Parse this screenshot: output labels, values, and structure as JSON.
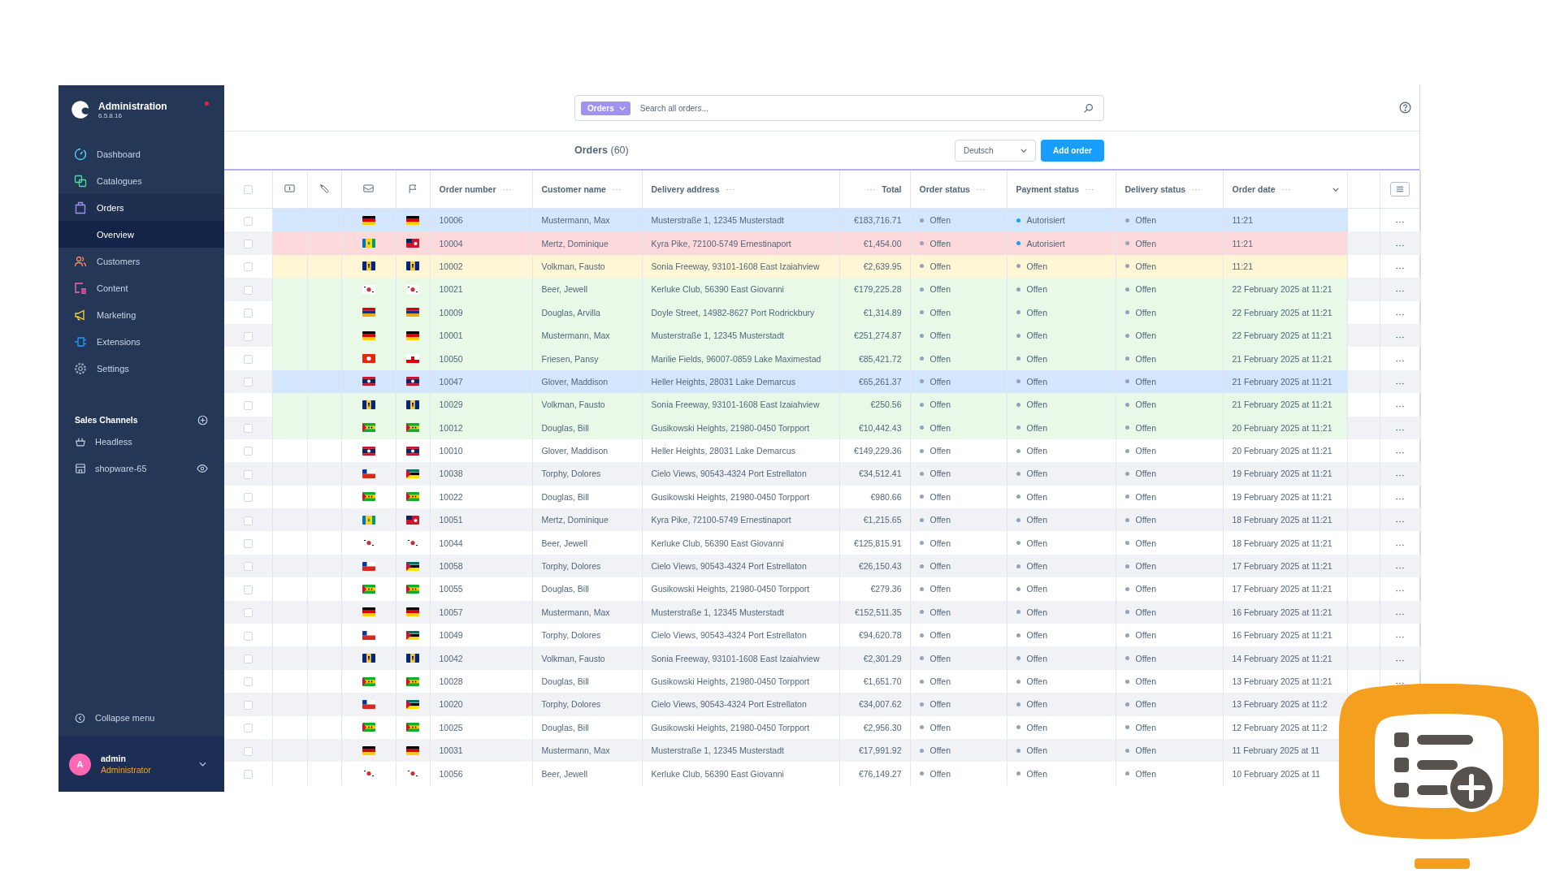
{
  "sidebar": {
    "title": "Administration",
    "version": "6.5.8.16",
    "notification": true,
    "items": [
      {
        "label": "Dashboard",
        "kind": "dashboard",
        "expanded": false,
        "selected": false
      },
      {
        "label": "Catalogues",
        "kind": "catalogues",
        "expanded": false,
        "selected": false
      },
      {
        "label": "Orders",
        "kind": "orders",
        "expanded": true,
        "selected": false,
        "children": [
          {
            "label": "Overview",
            "selected": true
          }
        ]
      },
      {
        "label": "Customers",
        "kind": "customers",
        "expanded": false,
        "selected": false
      },
      {
        "label": "Content",
        "kind": "content",
        "expanded": false,
        "selected": false
      },
      {
        "label": "Marketing",
        "kind": "marketing",
        "expanded": false,
        "selected": false
      },
      {
        "label": "Extensions",
        "kind": "extensions",
        "expanded": false,
        "selected": false
      },
      {
        "label": "Settings",
        "kind": "settings",
        "expanded": false,
        "selected": false
      }
    ],
    "sales_channels": {
      "title": "Sales Channels",
      "items": [
        {
          "label": "Headless",
          "kind": "headless"
        },
        {
          "label": "shopware-65",
          "kind": "storefront"
        }
      ]
    },
    "collapse": "Collapse menu",
    "user": {
      "initial": "A",
      "name": "admin",
      "role": "Administrator"
    }
  },
  "search": {
    "scope": "Orders",
    "placeholder": "Search all orders..."
  },
  "header": {
    "title": "Orders",
    "count": "(60)",
    "language": "Deutsch",
    "add_button": "Add order"
  },
  "table": {
    "header_checked": false,
    "columns": [
      {
        "kind": "checkbox"
      },
      {
        "kind": "money"
      },
      {
        "kind": "tag"
      },
      {
        "kind": "mail"
      },
      {
        "kind": "flag"
      },
      {
        "kind": "text",
        "label": "Order number",
        "sorted": false
      },
      {
        "kind": "text",
        "label": "Customer name",
        "sorted": false
      },
      {
        "kind": "text",
        "label": "Delivery address",
        "sorted": false
      },
      {
        "kind": "number",
        "label": "Total",
        "sorted": false
      },
      {
        "kind": "text",
        "label": "Order status",
        "sorted": false
      },
      {
        "kind": "text",
        "label": "Payment status",
        "sorted": false
      },
      {
        "kind": "text",
        "label": "Delivery status",
        "sorted": false
      },
      {
        "kind": "text",
        "label": "Order date",
        "sorted": true
      },
      {
        "kind": "blank"
      },
      {
        "kind": "settings"
      }
    ],
    "rows": [
      {
        "checked": false,
        "color": "#d4e6fd",
        "flags": [
          {
            "kind": "de"
          },
          {
            "kind": "de"
          }
        ],
        "number": "10006",
        "customer": "Mustermann, Max",
        "address": "Musterstraße 1, 12345 Musterstadt",
        "total": "€183,716.71",
        "order_status": {
          "text": "Offen",
          "color": "#94a3b8"
        },
        "payment_status": {
          "text": "Autorisiert",
          "color": "#189eff"
        },
        "delivery_status": {
          "text": "Offen",
          "color": "#94a3b8"
        },
        "date": "11:21"
      },
      {
        "checked": false,
        "color": "#fdd9dc",
        "flags": [
          {
            "kind": "vc"
          },
          {
            "kind": "bm"
          }
        ],
        "number": "10004",
        "customer": "Mertz, Dominique",
        "address": "Kyra Pike, 72100-5749 Ernestinaport",
        "total": "€1,454.00",
        "order_status": {
          "text": "Offen",
          "color": "#94a3b8"
        },
        "payment_status": {
          "text": "Autorisiert",
          "color": "#189eff"
        },
        "delivery_status": {
          "text": "Offen",
          "color": "#94a3b8"
        },
        "date": "11:21"
      },
      {
        "checked": false,
        "color": "#fef6d5",
        "flags": [
          {
            "kind": "bb"
          },
          {
            "kind": "bb"
          }
        ],
        "number": "10002",
        "customer": "Volkman, Fausto",
        "address": "Sonia Freeway, 93101-1608 East Izaiahview",
        "total": "€2,639.95",
        "order_status": {
          "text": "Offen",
          "color": "#94a3b8"
        },
        "payment_status": {
          "text": "Offen",
          "color": "#94a3b8"
        },
        "delivery_status": {
          "text": "Offen",
          "color": "#94a3b8"
        },
        "date": "11:21"
      },
      {
        "checked": false,
        "color": "#e8f9e8",
        "flags": [
          {
            "kind": "kr"
          },
          {
            "kind": "kr"
          }
        ],
        "number": "10021",
        "customer": "Beer, Jewell",
        "address": "Kerluke Club, 56390 East Giovanni",
        "total": "€179,225.28",
        "order_status": {
          "text": "Offen",
          "color": "#94a3b8"
        },
        "payment_status": {
          "text": "Offen",
          "color": "#94a3b8"
        },
        "delivery_status": {
          "text": "Offen",
          "color": "#94a3b8"
        },
        "date": "22 February 2025 at 11:21"
      },
      {
        "checked": false,
        "color": "#e8f9e8",
        "flags": [
          {
            "kind": "am"
          },
          {
            "kind": "am"
          }
        ],
        "number": "10009",
        "customer": "Douglas, Arvilla",
        "address": "Doyle Street, 14982-8627 Port Rodrickbury",
        "total": "€1,314.89",
        "order_status": {
          "text": "Offen",
          "color": "#94a3b8"
        },
        "payment_status": {
          "text": "Offen",
          "color": "#94a3b8"
        },
        "delivery_status": {
          "text": "Offen",
          "color": "#94a3b8"
        },
        "date": "22 February 2025 at 11:21"
      },
      {
        "checked": false,
        "color": "#e8f9e8",
        "flags": [
          {
            "kind": "de"
          },
          {
            "kind": "de"
          }
        ],
        "number": "10001",
        "customer": "Mustermann, Max",
        "address": "Musterstraße 1, 12345 Musterstadt",
        "total": "€251,274.87",
        "order_status": {
          "text": "Offen",
          "color": "#94a3b8"
        },
        "payment_status": {
          "text": "Offen",
          "color": "#94a3b8"
        },
        "delivery_status": {
          "text": "Offen",
          "color": "#94a3b8"
        },
        "date": "22 February 2025 at 11:21"
      },
      {
        "checked": false,
        "color": "#e8f9e8",
        "flags": [
          {
            "kind": "hk"
          },
          {
            "kind": "gi"
          }
        ],
        "number": "10050",
        "customer": "Friesen, Pansy",
        "address": "Marilie Fields, 96007-0859 Lake Maximestad",
        "total": "€85,421.72",
        "order_status": {
          "text": "Offen",
          "color": "#94a3b8"
        },
        "payment_status": {
          "text": "Offen",
          "color": "#94a3b8"
        },
        "delivery_status": {
          "text": "Offen",
          "color": "#94a3b8"
        },
        "date": "21 February 2025 at 11:21"
      },
      {
        "checked": false,
        "color": "#d4e6fd",
        "flags": [
          {
            "kind": "la"
          },
          {
            "kind": "la"
          }
        ],
        "number": "10047",
        "customer": "Glover, Maddison",
        "address": "Heller Heights, 28031 Lake Demarcus",
        "total": "€65,261.37",
        "order_status": {
          "text": "Offen",
          "color": "#94a3b8"
        },
        "payment_status": {
          "text": "Offen",
          "color": "#94a3b8"
        },
        "delivery_status": {
          "text": "Offen",
          "color": "#94a3b8"
        },
        "date": "21 February 2025 at 11:21"
      },
      {
        "checked": false,
        "color": "#e8f9e8",
        "flags": [
          {
            "kind": "bb"
          },
          {
            "kind": "bb"
          }
        ],
        "number": "10029",
        "customer": "Volkman, Fausto",
        "address": "Sonia Freeway, 93101-1608 East Izaiahview",
        "total": "€250.56",
        "order_status": {
          "text": "Offen",
          "color": "#94a3b8"
        },
        "payment_status": {
          "text": "Offen",
          "color": "#94a3b8"
        },
        "delivery_status": {
          "text": "Offen",
          "color": "#94a3b8"
        },
        "date": "21 February 2025 at 11:21"
      },
      {
        "checked": false,
        "color": "#e8f9e8",
        "flags": [
          {
            "kind": "st"
          },
          {
            "kind": "st"
          }
        ],
        "number": "10012",
        "customer": "Douglas, Bill",
        "address": "Gusikowski Heights, 21980-0450 Torpport",
        "total": "€10,442.43",
        "order_status": {
          "text": "Offen",
          "color": "#94a3b8"
        },
        "payment_status": {
          "text": "Offen",
          "color": "#94a3b8"
        },
        "delivery_status": {
          "text": "Offen",
          "color": "#94a3b8"
        },
        "date": "20 February 2025 at 11:21"
      },
      {
        "checked": false,
        "flags": [
          {
            "kind": "la"
          },
          {
            "kind": "la"
          }
        ],
        "number": "10010",
        "customer": "Glover, Maddison",
        "address": "Heller Heights, 28031 Lake Demarcus",
        "total": "€149,229.36",
        "order_status": {
          "text": "Offen",
          "color": "#94a3b8"
        },
        "payment_status": {
          "text": "Offen",
          "color": "#94a3b8"
        },
        "delivery_status": {
          "text": "Offen",
          "color": "#94a3b8"
        },
        "date": "20 February 2025 at 11:21"
      },
      {
        "checked": false,
        "flags": [
          {
            "kind": "cl"
          },
          {
            "kind": "mz"
          }
        ],
        "number": "10038",
        "customer": "Torphy, Dolores",
        "address": "Cielo Views, 90543-4324 Port Estrellaton",
        "total": "€34,512.41",
        "order_status": {
          "text": "Offen",
          "color": "#94a3b8"
        },
        "payment_status": {
          "text": "Offen",
          "color": "#94a3b8"
        },
        "delivery_status": {
          "text": "Offen",
          "color": "#94a3b8"
        },
        "date": "19 February 2025 at 11:21"
      },
      {
        "checked": false,
        "flags": [
          {
            "kind": "st"
          },
          {
            "kind": "st"
          }
        ],
        "number": "10022",
        "customer": "Douglas, Bill",
        "address": "Gusikowski Heights, 21980-0450 Torpport",
        "total": "€980.66",
        "order_status": {
          "text": "Offen",
          "color": "#94a3b8"
        },
        "payment_status": {
          "text": "Offen",
          "color": "#94a3b8"
        },
        "delivery_status": {
          "text": "Offen",
          "color": "#94a3b8"
        },
        "date": "19 February 2025 at 11:21"
      },
      {
        "checked": false,
        "flags": [
          {
            "kind": "vc"
          },
          {
            "kind": "bm"
          }
        ],
        "number": "10051",
        "customer": "Mertz, Dominique",
        "address": "Kyra Pike, 72100-5749 Ernestinaport",
        "total": "€1,215.65",
        "order_status": {
          "text": "Offen",
          "color": "#94a3b8"
        },
        "payment_status": {
          "text": "Offen",
          "color": "#94a3b8"
        },
        "delivery_status": {
          "text": "Offen",
          "color": "#94a3b8"
        },
        "date": "18 February 2025 at 11:21"
      },
      {
        "checked": false,
        "flags": [
          {
            "kind": "kr"
          },
          {
            "kind": "kr"
          }
        ],
        "number": "10044",
        "customer": "Beer, Jewell",
        "address": "Kerluke Club, 56390 East Giovanni",
        "total": "€125,815.91",
        "order_status": {
          "text": "Offen",
          "color": "#94a3b8"
        },
        "payment_status": {
          "text": "Offen",
          "color": "#94a3b8"
        },
        "delivery_status": {
          "text": "Offen",
          "color": "#94a3b8"
        },
        "date": "18 February 2025 at 11:21"
      },
      {
        "checked": false,
        "flags": [
          {
            "kind": "cl"
          },
          {
            "kind": "mz"
          }
        ],
        "number": "10058",
        "customer": "Torphy, Dolores",
        "address": "Cielo Views, 90543-4324 Port Estrellaton",
        "total": "€26,150.43",
        "order_status": {
          "text": "Offen",
          "color": "#94a3b8"
        },
        "payment_status": {
          "text": "Offen",
          "color": "#94a3b8"
        },
        "delivery_status": {
          "text": "Offen",
          "color": "#94a3b8"
        },
        "date": "17 February 2025 at 11:21"
      },
      {
        "checked": false,
        "flags": [
          {
            "kind": "st"
          },
          {
            "kind": "st"
          }
        ],
        "number": "10055",
        "customer": "Douglas, Bill",
        "address": "Gusikowski Heights, 21980-0450 Torpport",
        "total": "€279.36",
        "order_status": {
          "text": "Offen",
          "color": "#94a3b8"
        },
        "payment_status": {
          "text": "Offen",
          "color": "#94a3b8"
        },
        "delivery_status": {
          "text": "Offen",
          "color": "#94a3b8"
        },
        "date": "17 February 2025 at 11:21"
      },
      {
        "checked": false,
        "flags": [
          {
            "kind": "de"
          },
          {
            "kind": "de"
          }
        ],
        "number": "10057",
        "customer": "Mustermann, Max",
        "address": "Musterstraße 1, 12345 Musterstadt",
        "total": "€152,511.35",
        "order_status": {
          "text": "Offen",
          "color": "#94a3b8"
        },
        "payment_status": {
          "text": "Offen",
          "color": "#94a3b8"
        },
        "delivery_status": {
          "text": "Offen",
          "color": "#94a3b8"
        },
        "date": "16 February 2025 at 11:21"
      },
      {
        "checked": false,
        "flags": [
          {
            "kind": "cl"
          },
          {
            "kind": "mz"
          }
        ],
        "number": "10049",
        "customer": "Torphy, Dolores",
        "address": "Cielo Views, 90543-4324 Port Estrellaton",
        "total": "€94,620.78",
        "order_status": {
          "text": "Offen",
          "color": "#94a3b8"
        },
        "payment_status": {
          "text": "Offen",
          "color": "#94a3b8"
        },
        "delivery_status": {
          "text": "Offen",
          "color": "#94a3b8"
        },
        "date": "16 February 2025 at 11:21"
      },
      {
        "checked": false,
        "flags": [
          {
            "kind": "bb"
          },
          {
            "kind": "bb"
          }
        ],
        "number": "10042",
        "customer": "Volkman, Fausto",
        "address": "Sonia Freeway, 93101-1608 East Izaiahview",
        "total": "€2,301.29",
        "order_status": {
          "text": "Offen",
          "color": "#94a3b8"
        },
        "payment_status": {
          "text": "Offen",
          "color": "#94a3b8"
        },
        "delivery_status": {
          "text": "Offen",
          "color": "#94a3b8"
        },
        "date": "14 February 2025 at 11:21"
      },
      {
        "checked": false,
        "flags": [
          {
            "kind": "st"
          },
          {
            "kind": "st"
          }
        ],
        "number": "10028",
        "customer": "Douglas, Bill",
        "address": "Gusikowski Heights, 21980-0450 Torpport",
        "total": "€1,651.70",
        "order_status": {
          "text": "Offen",
          "color": "#94a3b8"
        },
        "payment_status": {
          "text": "Offen",
          "color": "#94a3b8"
        },
        "delivery_status": {
          "text": "Offen",
          "color": "#94a3b8"
        },
        "date": "13 February 2025 at 11:21"
      },
      {
        "checked": false,
        "flags": [
          {
            "kind": "cl"
          },
          {
            "kind": "mz"
          }
        ],
        "number": "10020",
        "customer": "Torphy, Dolores",
        "address": "Cielo Views, 90543-4324 Port Estrellaton",
        "total": "€34,007.62",
        "order_status": {
          "text": "Offen",
          "color": "#94a3b8"
        },
        "payment_status": {
          "text": "Offen",
          "color": "#94a3b8"
        },
        "delivery_status": {
          "text": "Offen",
          "color": "#94a3b8"
        },
        "date": "13 February 2025 at 11:2"
      },
      {
        "checked": false,
        "flags": [
          {
            "kind": "st"
          },
          {
            "kind": "st"
          }
        ],
        "number": "10025",
        "customer": "Douglas, Bill",
        "address": "Gusikowski Heights, 21980-0450 Torpport",
        "total": "€2,956.30",
        "order_status": {
          "text": "Offen",
          "color": "#94a3b8"
        },
        "payment_status": {
          "text": "Offen",
          "color": "#94a3b8"
        },
        "delivery_status": {
          "text": "Offen",
          "color": "#94a3b8"
        },
        "date": "12 February 2025 at 11:2"
      },
      {
        "checked": false,
        "flags": [
          {
            "kind": "de"
          },
          {
            "kind": "de"
          }
        ],
        "number": "10031",
        "customer": "Mustermann, Max",
        "address": "Musterstraße 1, 12345 Musterstadt",
        "total": "€17,991.92",
        "order_status": {
          "text": "Offen",
          "color": "#94a3b8"
        },
        "payment_status": {
          "text": "Offen",
          "color": "#94a3b8"
        },
        "delivery_status": {
          "text": "Offen",
          "color": "#94a3b8"
        },
        "date": "11 February 2025 at 11"
      },
      {
        "checked": false,
        "flags": [
          {
            "kind": "kr"
          },
          {
            "kind": "kr"
          }
        ],
        "number": "10056",
        "customer": "Beer, Jewell",
        "address": "Kerluke Club, 56390 East Giovanni",
        "total": "€76,149.27",
        "order_status": {
          "text": "Offen",
          "color": "#94a3b8"
        },
        "payment_status": {
          "text": "Offen",
          "color": "#94a3b8"
        },
        "delivery_status": {
          "text": "Offen",
          "color": "#94a3b8"
        },
        "date": "10 February 2025 at 11"
      }
    ]
  }
}
